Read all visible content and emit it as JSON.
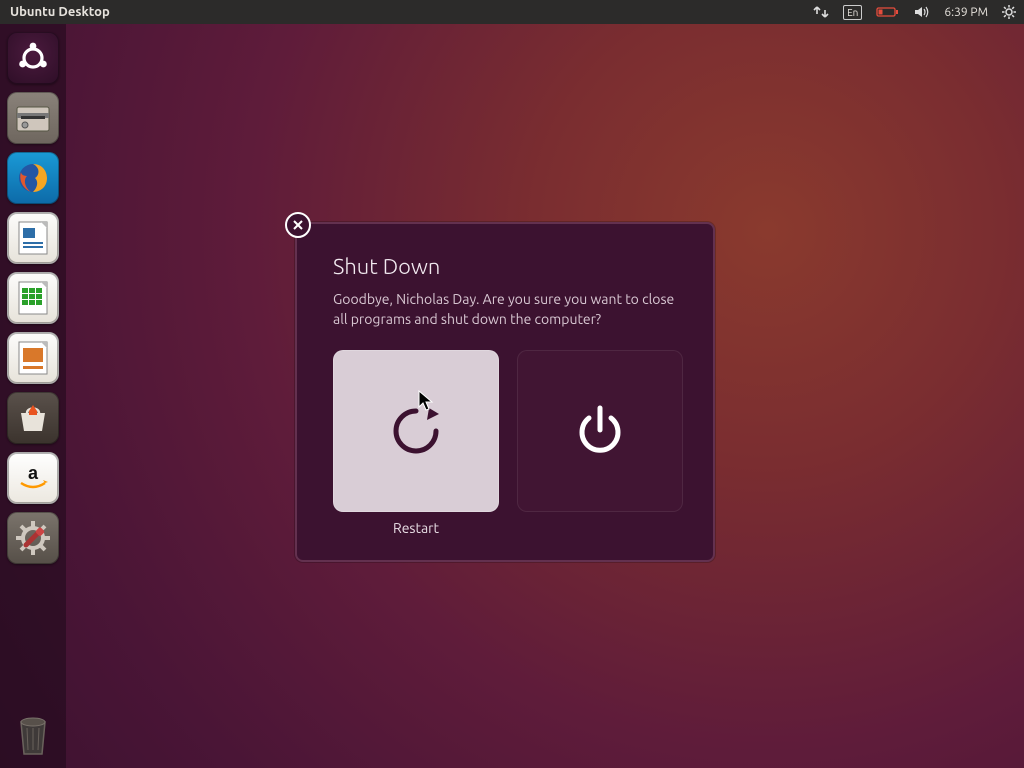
{
  "menubar": {
    "title": "Ubuntu Desktop",
    "lang": "En",
    "time": "6:39 PM"
  },
  "launcher": {
    "items": [
      {
        "name": "ubuntu-dash"
      },
      {
        "name": "files"
      },
      {
        "name": "firefox"
      },
      {
        "name": "libreoffice-writer"
      },
      {
        "name": "libreoffice-calc"
      },
      {
        "name": "libreoffice-impress"
      },
      {
        "name": "ubuntu-software"
      },
      {
        "name": "amazon"
      },
      {
        "name": "system-settings"
      }
    ]
  },
  "dialog": {
    "title": "Shut Down",
    "message": "Goodbye, Nicholas Day. Are you sure you want to close all programs and shut down the computer?",
    "restart_label": "Restart",
    "shutdown_label": ""
  }
}
